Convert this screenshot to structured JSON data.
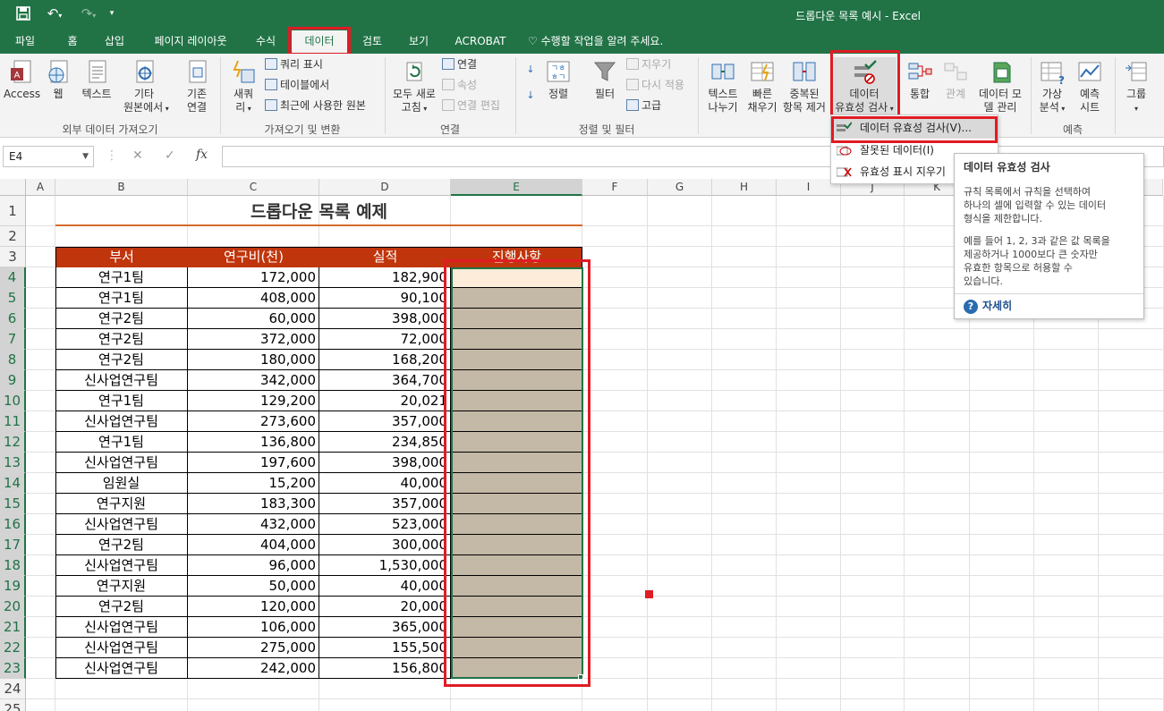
{
  "window": {
    "title": "드롭다운 목록 예시 - Excel"
  },
  "quick_access": {
    "save": "save-icon",
    "undo": "undo-icon",
    "redo": "redo-icon",
    "customize": "customize-icon"
  },
  "tabs": [
    "파일",
    "홈",
    "삽입",
    "페이지 레이아웃",
    "수식",
    "데이터",
    "검토",
    "보기",
    "ACROBAT"
  ],
  "active_tab": "데이터",
  "tell_me": "수행할 작업을 알려 주세요.",
  "ribbon": {
    "external": {
      "access": "Access",
      "web": "웹",
      "text": "텍스트",
      "other1": "기타",
      "other2": "원본에서",
      "existing1": "기존",
      "existing2": "연결",
      "group": "외부 데이터 가져오기"
    },
    "transform": {
      "newq1": "새쿼",
      "newq2": "리",
      "show_queries": "쿼리 표시",
      "from_table": "테이블에서",
      "recent_sources": "최근에 사용한 원본",
      "group": "가져오기 및 변환"
    },
    "connections": {
      "refresh1": "모두 새로",
      "refresh2": "고침",
      "connections": "연결",
      "properties": "속성",
      "edit_links": "연결 편집",
      "group": "연결"
    },
    "sort_filter": {
      "sort": "정렬",
      "filter": "필터",
      "clear": "지우기",
      "reapply": "다시 적용",
      "advanced": "고급",
      "group": "정렬 및 필터"
    },
    "tools": {
      "t2c1": "텍스트",
      "t2c2": "나누기",
      "flash1": "빠른",
      "flash2": "채우기",
      "dup1": "중복된",
      "dup2": "항목 제거",
      "dv1": "데이터",
      "dv2": "유효성 검사",
      "consolidate": "통합",
      "relations": "관계",
      "model1": "데이터 모",
      "model2": "델 관리"
    },
    "forecast": {
      "whatif1": "가상",
      "whatif2": "분석",
      "sheet1": "예측",
      "sheet2": "시트",
      "group": "예측"
    },
    "outline": {
      "group_btn": "그룹"
    }
  },
  "formula_bar": {
    "name_box": "E4",
    "cancel": "✕",
    "enter": "✓",
    "fx": "fx",
    "value": ""
  },
  "columns": [
    "A",
    "B",
    "C",
    "D",
    "E",
    "F",
    "G",
    "H",
    "I",
    "J",
    "K"
  ],
  "rows": [
    "1",
    "2",
    "3",
    "4",
    "5",
    "6",
    "7",
    "8",
    "9",
    "10",
    "11",
    "12",
    "13",
    "14",
    "15",
    "16",
    "17",
    "18",
    "19",
    "20",
    "21",
    "22",
    "23",
    "24",
    "25"
  ],
  "sheet": {
    "title": "드롭다운 목록 예제",
    "headers": [
      "부서",
      "연구비(천)",
      "실적",
      "진행사항"
    ],
    "data": [
      [
        "연구1팀",
        "172,000",
        "182,900"
      ],
      [
        "연구1팀",
        "408,000",
        "90,100"
      ],
      [
        "연구2팀",
        "60,000",
        "398,000"
      ],
      [
        "연구2팀",
        "372,000",
        "72,000"
      ],
      [
        "연구2팀",
        "180,000",
        "168,200"
      ],
      [
        "신사업연구팀",
        "342,000",
        "364,700"
      ],
      [
        "연구1팀",
        "129,200",
        "20,021"
      ],
      [
        "신사업연구팀",
        "273,600",
        "357,000"
      ],
      [
        "연구1팀",
        "136,800",
        "234,850"
      ],
      [
        "신사업연구팀",
        "197,600",
        "398,000"
      ],
      [
        "임원실",
        "15,200",
        "40,000"
      ],
      [
        "연구지원",
        "183,300",
        "357,000"
      ],
      [
        "신사업연구팀",
        "432,000",
        "523,000"
      ],
      [
        "연구2팀",
        "404,000",
        "300,000"
      ],
      [
        "신사업연구팀",
        "96,000",
        "1,530,000"
      ],
      [
        "연구지원",
        "50,000",
        "40,000"
      ],
      [
        "연구2팀",
        "120,000",
        "20,000"
      ],
      [
        "신사업연구팀",
        "106,000",
        "365,000"
      ],
      [
        "신사업연구팀",
        "275,000",
        "155,500"
      ],
      [
        "신사업연구팀",
        "242,000",
        "156,800"
      ]
    ]
  },
  "dropdown": {
    "items": [
      "데이터 유효성 검사(V)...",
      "잘못된 데이터(I)",
      "유효성 표시 지우기"
    ]
  },
  "tooltip": {
    "title": "데이터 유효성 검사",
    "body1": "규칙 목록에서 규칙을 선택하여\n하나의 셀에 입력할 수 있는 데이터\n형식을 제한합니다.",
    "body2": "예를 들어 1, 2, 3과 같은 값 목록을\n제공하거나 1000보다 큰 숫자만\n유효한 항목으로 허용할 수\n있습니다.",
    "more": "자세히"
  },
  "colors": {
    "excel_green": "#217346",
    "header_fill": "#c0350c",
    "highlight_red": "#e01b24",
    "selection_fill": "#c4b8a6"
  }
}
